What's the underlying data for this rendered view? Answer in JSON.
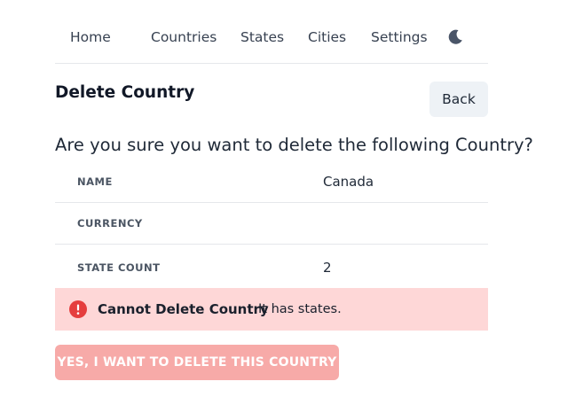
{
  "nav": {
    "items": [
      {
        "label": "Home"
      },
      {
        "label": "Countries"
      },
      {
        "label": "States"
      },
      {
        "label": "Cities"
      },
      {
        "label": "Settings"
      }
    ],
    "theme_toggle_icon": "moon-icon"
  },
  "header": {
    "title": "Delete Country",
    "back_label": "Back"
  },
  "question": "Are you sure you want to delete the following Country?",
  "details": [
    {
      "label": "NAME",
      "value": "Canada"
    },
    {
      "label": "CURRENCY",
      "value": ""
    },
    {
      "label": "STATE COUNT",
      "value": "2"
    }
  ],
  "alert": {
    "icon": "error-icon",
    "title": "Cannot Delete Country",
    "description": "It has states.",
    "background": "#fed7d7",
    "icon_color": "#e53e3e"
  },
  "delete_button": {
    "label": "YES, I WANT TO DELETE THIS COUNTRY",
    "disabled": true,
    "color": "#f7aaa8"
  }
}
